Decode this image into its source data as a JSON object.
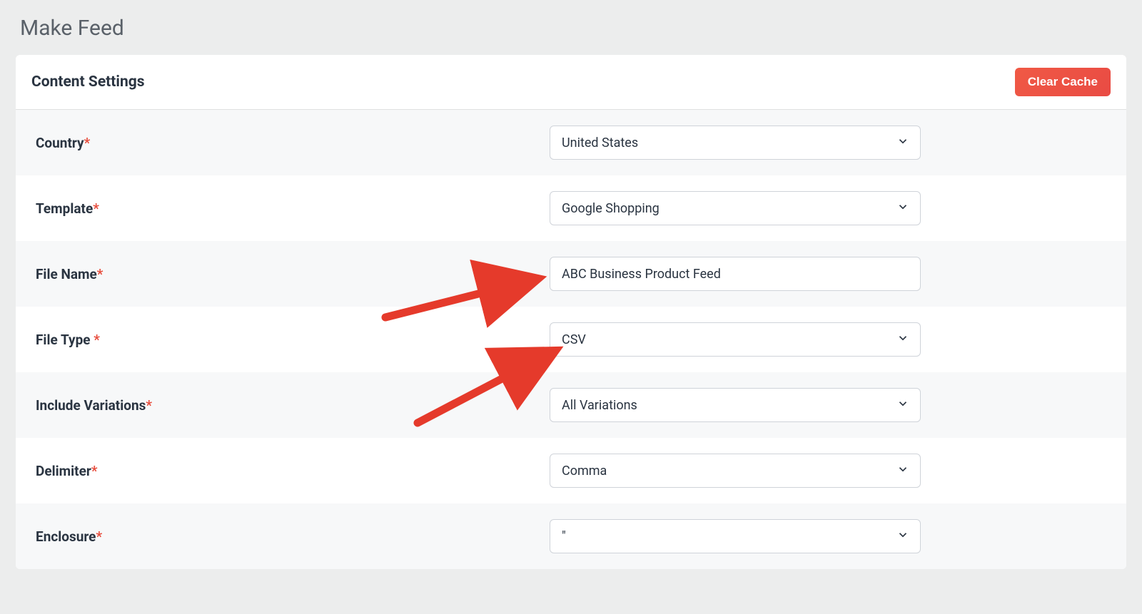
{
  "page": {
    "title": "Make Feed"
  },
  "header": {
    "title": "Content Settings",
    "clear_cache_label": "Clear Cache"
  },
  "fields": {
    "country": {
      "label": "Country",
      "value": "United States",
      "type": "select"
    },
    "template": {
      "label": "Template",
      "value": "Google Shopping",
      "type": "select"
    },
    "file_name": {
      "label": "File Name",
      "value": "ABC Business Product Feed",
      "type": "text"
    },
    "file_type": {
      "label": "File Type ",
      "value": "CSV",
      "type": "select"
    },
    "include_variations": {
      "label": "Include Variations",
      "value": "All Variations",
      "type": "select"
    },
    "delimiter": {
      "label": "Delimiter",
      "value": "Comma",
      "type": "select"
    },
    "enclosure": {
      "label": "Enclosure",
      "value": "\"",
      "type": "select"
    }
  },
  "required_marker": "*",
  "annotations": {
    "arrow_color": "#e53a2b"
  }
}
